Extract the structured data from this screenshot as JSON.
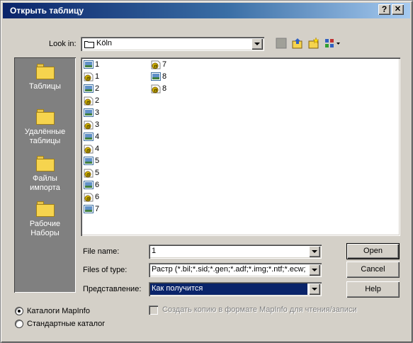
{
  "window": {
    "title": "Открыть таблицу",
    "help_btn": "?",
    "close_btn": "✕"
  },
  "lookin": {
    "label": "Look in:",
    "value": "Köln"
  },
  "places": [
    {
      "label": "Таблицы"
    },
    {
      "label": "Удалённые таблицы"
    },
    {
      "label": "Файлы импорта"
    },
    {
      "label": "Рабочие Наборы"
    }
  ],
  "files": [
    {
      "name": "1",
      "icon": "raster-image-icon"
    },
    {
      "name": "1",
      "icon": "workspace-icon"
    },
    {
      "name": "2",
      "icon": "raster-image-icon"
    },
    {
      "name": "2",
      "icon": "workspace-icon"
    },
    {
      "name": "3",
      "icon": "raster-image-icon"
    },
    {
      "name": "3",
      "icon": "workspace-icon"
    },
    {
      "name": "4",
      "icon": "raster-image-icon"
    },
    {
      "name": "4",
      "icon": "workspace-icon"
    },
    {
      "name": "5",
      "icon": "raster-image-icon"
    },
    {
      "name": "5",
      "icon": "workspace-icon"
    },
    {
      "name": "6",
      "icon": "raster-image-icon"
    },
    {
      "name": "6",
      "icon": "workspace-icon"
    },
    {
      "name": "7",
      "icon": "raster-image-icon"
    },
    {
      "name": "7",
      "icon": "workspace-icon"
    },
    {
      "name": "8",
      "icon": "raster-image-icon"
    },
    {
      "name": "8",
      "icon": "workspace-icon"
    }
  ],
  "filename": {
    "label": "File name:",
    "value": "1"
  },
  "filetype": {
    "label": "Files of type:",
    "value": "Растр (*.bil;*.sid;*.gen;*.adf;*.img;*.ntf;*.ecw;*.u"
  },
  "view": {
    "label": "Представление:",
    "value": "Как получится"
  },
  "buttons": {
    "open": "Open",
    "cancel": "Cancel",
    "help": "Help"
  },
  "copy_checkbox": {
    "label": "Создать копию в формате MapInfo для чтения/записи",
    "checked": false
  },
  "radios": [
    {
      "label": "Каталоги MapInfo",
      "selected": true
    },
    {
      "label": "Стандартные каталог",
      "selected": false
    }
  ],
  "colors": {
    "title_start": "#0a246a",
    "title_end": "#a6caf0",
    "face": "#d4d0c8",
    "highlight": "#0a246a"
  }
}
